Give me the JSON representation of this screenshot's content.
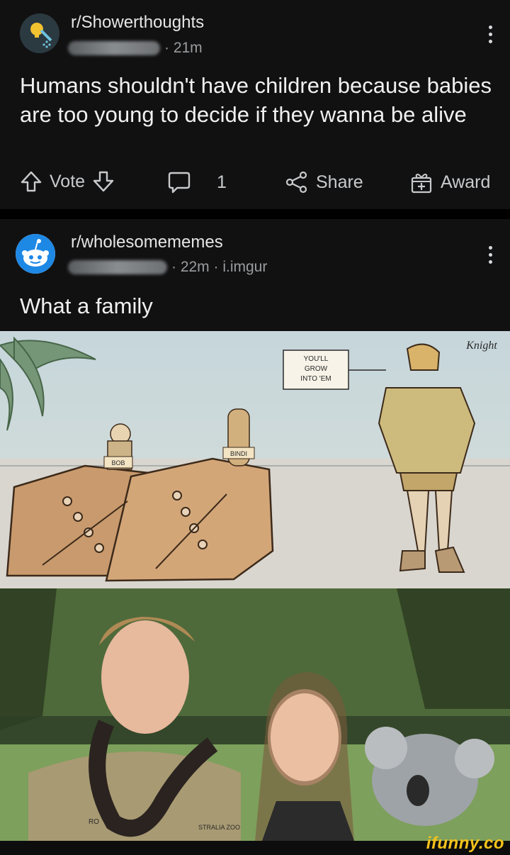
{
  "post1": {
    "subreddit": "r/Showerthoughts",
    "meta_suffix": "· 21m",
    "title": "Humans shouldn't have children because babies are too young to decide if they wanna be alive",
    "actions": {
      "vote": "Vote",
      "comment_count": "1",
      "share": "Share",
      "award": "Award"
    }
  },
  "post2": {
    "subreddit": "r/wholesomememes",
    "meta_suffix": "· 22m · i.imgur",
    "title": "What a family"
  },
  "comic": {
    "speech": "YOU'LL GROW INTO 'EM",
    "label_left": "BOB",
    "label_right": "BINDI",
    "signature": "Knight"
  },
  "photo": {
    "shirt_text_left": "RO",
    "shirt_text_right": "STRALIA ZOO"
  },
  "watermark": "ifunny.co"
}
